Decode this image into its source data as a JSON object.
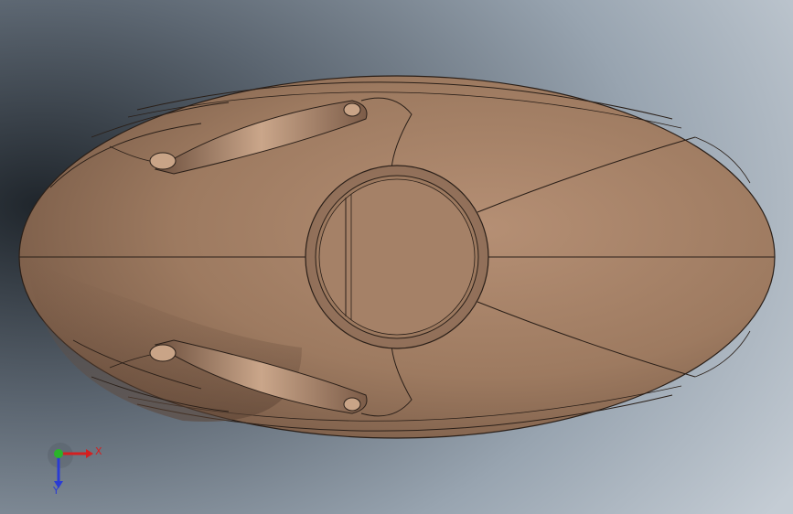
{
  "viewport": {
    "background_top": "#b8c2cc",
    "background_dark": "#2e353d",
    "model": {
      "name": "housing-part",
      "colors": {
        "body": "#a17c62",
        "body_light": "#b79377",
        "body_shadow": "#5d4535",
        "edge": "#2a1f18"
      }
    }
  },
  "triad": {
    "x_label": "X",
    "y_label": "Y",
    "colors": {
      "x": "#d42020",
      "y": "#2a3bd4",
      "z": "#2bb32b"
    }
  }
}
